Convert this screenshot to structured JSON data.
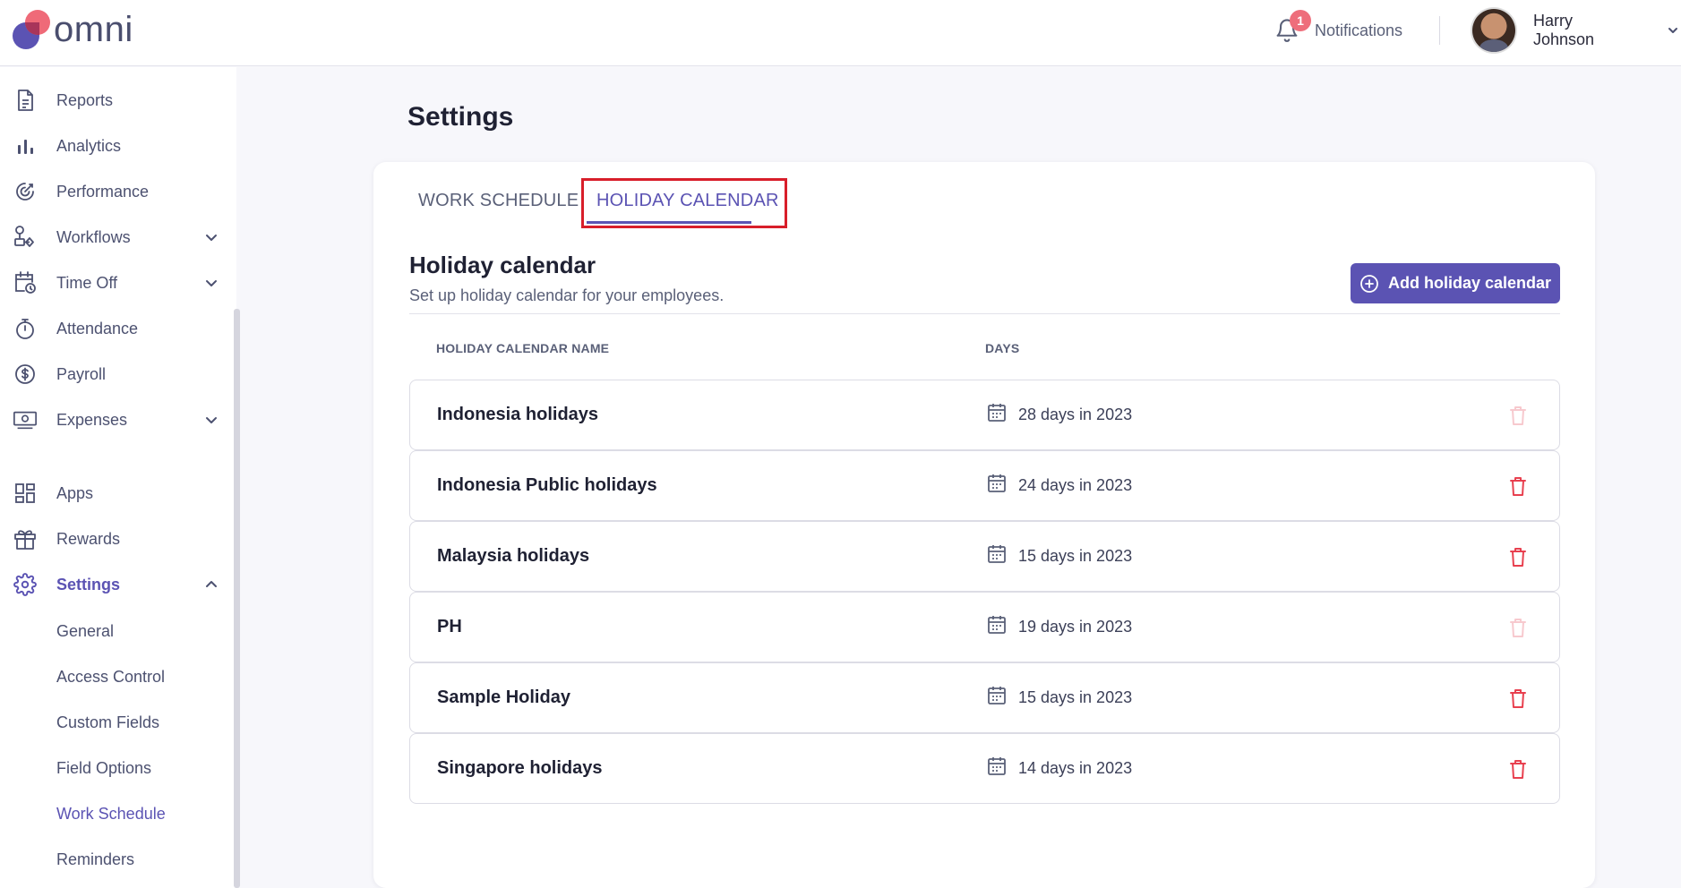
{
  "app": {
    "logo_text": "omni"
  },
  "header": {
    "notifications_label": "Notifications",
    "notifications_count": "1",
    "user_name": "Harry Johnson"
  },
  "sidebar": {
    "items": [
      {
        "label": "Reports",
        "icon": "document-icon"
      },
      {
        "label": "Analytics",
        "icon": "bar-chart-icon"
      },
      {
        "label": "Performance",
        "icon": "target-icon"
      },
      {
        "label": "Workflows",
        "icon": "workflow-icon",
        "expandable": true
      },
      {
        "label": "Time Off",
        "icon": "calendar-clock-icon",
        "expandable": true
      },
      {
        "label": "Attendance",
        "icon": "stopwatch-icon"
      },
      {
        "label": "Payroll",
        "icon": "dollar-icon"
      },
      {
        "label": "Expenses",
        "icon": "money-icon",
        "expandable": true
      },
      {
        "label": "Apps",
        "icon": "grid-icon"
      },
      {
        "label": "Rewards",
        "icon": "gift-icon"
      },
      {
        "label": "Settings",
        "icon": "gear-icon",
        "expanded": true,
        "active": true
      }
    ],
    "settings_sub": [
      "General",
      "Access Control",
      "Custom Fields",
      "Field Options",
      "Work Schedule",
      "Reminders"
    ]
  },
  "page": {
    "title": "Settings",
    "tabs": [
      "WORK SCHEDULE",
      "HOLIDAY CALENDAR"
    ],
    "active_tab": "HOLIDAY CALENDAR",
    "section_title": "Holiday calendar",
    "section_subtitle": "Set up holiday calendar for your employees.",
    "add_button": "Add holiday calendar",
    "columns": [
      "HOLIDAY CALENDAR NAME",
      "DAYS"
    ],
    "rows": [
      {
        "name": "Indonesia holidays",
        "days": "28 days in 2023",
        "delete_enabled": false
      },
      {
        "name": "Indonesia Public holidays",
        "days": "24 days in 2023",
        "delete_enabled": true
      },
      {
        "name": "Malaysia holidays",
        "days": "15 days in 2023",
        "delete_enabled": true
      },
      {
        "name": "PH",
        "days": "19 days in 2023",
        "delete_enabled": false
      },
      {
        "name": "Sample Holiday",
        "days": "15 days in 2023",
        "delete_enabled": true
      },
      {
        "name": "Singapore holidays",
        "days": "14 days in 2023",
        "delete_enabled": true
      }
    ]
  },
  "colors": {
    "accent": "#5b53b3",
    "danger": "#e8404f",
    "danger_disabled": "#f7c9ce",
    "highlight_box": "#d81e2a"
  }
}
